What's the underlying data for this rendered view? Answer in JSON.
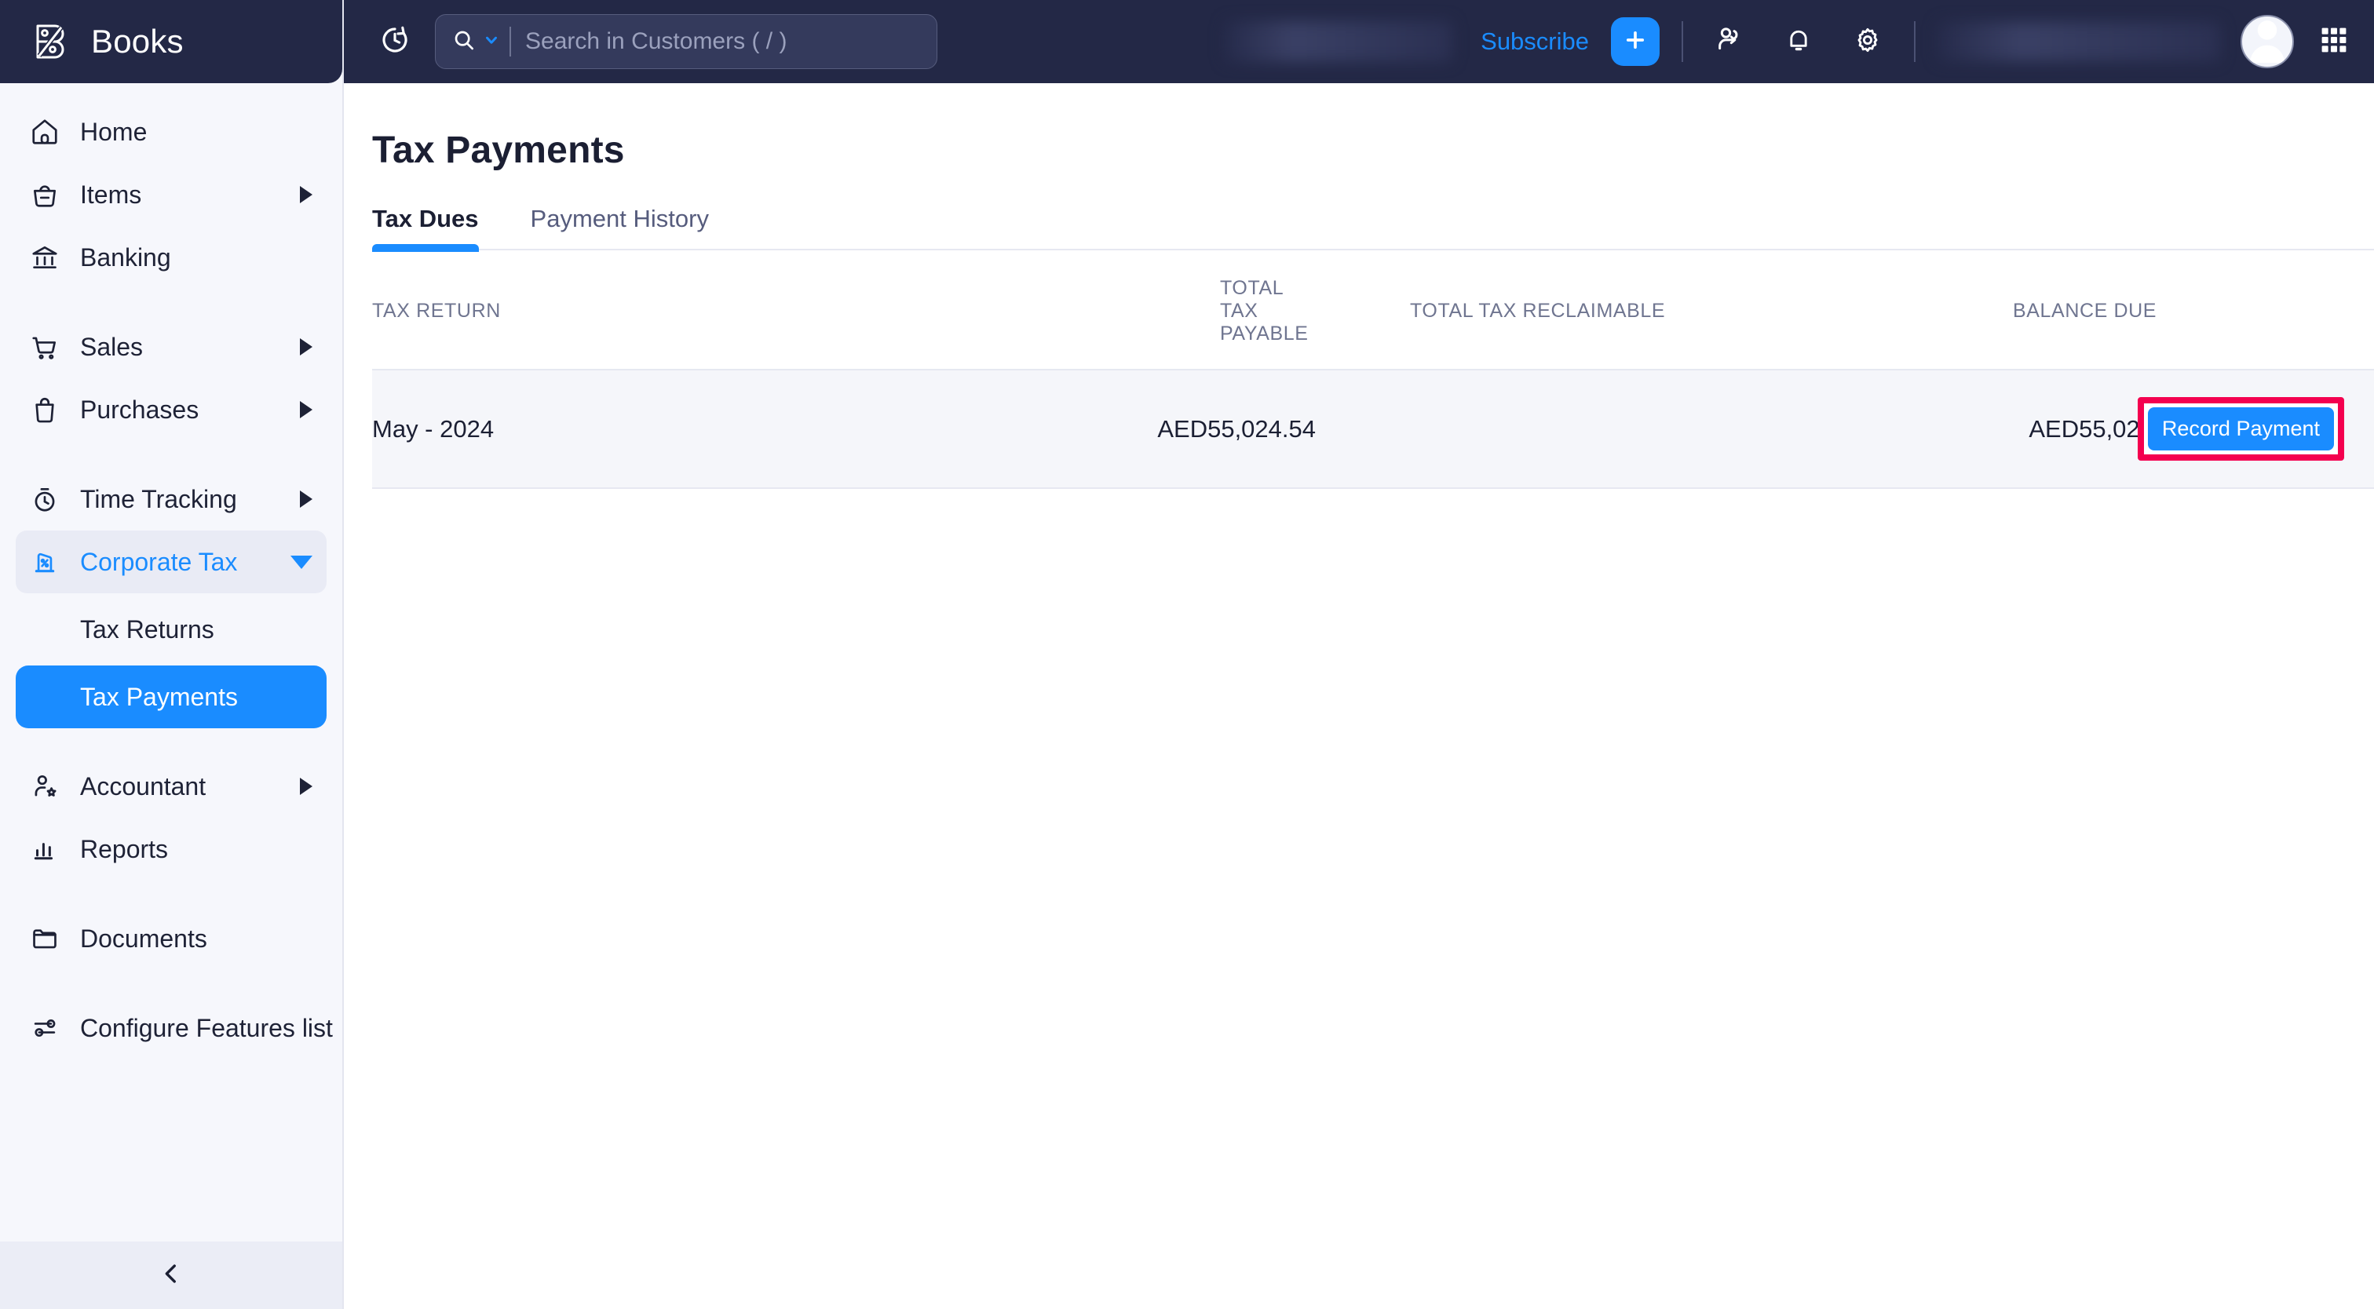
{
  "brand": {
    "name": "Books",
    "logo_icon": "zoho-books-logo-icon"
  },
  "sidebar": {
    "items": [
      {
        "label": "Home",
        "icon": "home-icon",
        "expandable": false
      },
      {
        "label": "Items",
        "icon": "basket-icon",
        "expandable": true
      },
      {
        "label": "Banking",
        "icon": "bank-icon",
        "expandable": false
      },
      {
        "label": "Sales",
        "icon": "shopping-cart-icon",
        "expandable": true
      },
      {
        "label": "Purchases",
        "icon": "shopping-bag-icon",
        "expandable": true
      },
      {
        "label": "Time Tracking",
        "icon": "stopwatch-icon",
        "expandable": true
      },
      {
        "label": "Corporate Tax",
        "icon": "tax-percent-icon",
        "expandable": true,
        "expanded": true
      },
      {
        "label": "Accountant",
        "icon": "accountant-icon",
        "expandable": true
      },
      {
        "label": "Reports",
        "icon": "bar-chart-icon",
        "expandable": false
      },
      {
        "label": "Documents",
        "icon": "folder-icon",
        "expandable": false
      },
      {
        "label": "Configure Features list",
        "icon": "sliders-icon",
        "expandable": false
      }
    ],
    "corporate_tax_children": [
      {
        "label": "Tax Returns",
        "active": false
      },
      {
        "label": "Tax Payments",
        "active": true
      }
    ],
    "collapse_icon": "chevron-left-icon"
  },
  "topbar": {
    "history_icon": "clock-history-icon",
    "search": {
      "icon": "search-icon",
      "dropdown_icon": "chevron-down-icon",
      "placeholder": "Search in Customers ( / )",
      "value": ""
    },
    "trial_info_redacted": "",
    "subscribe_label": "Subscribe",
    "create_new_icon": "plus-icon",
    "referral_icon": "refer-friend-icon",
    "notifications_icon": "bell-icon",
    "settings_icon": "gear-icon",
    "organization_redacted": "",
    "avatar_icon": "user-avatar-icon",
    "apps_icon": "apps-grid-icon"
  },
  "main": {
    "page_title": "Tax Payments",
    "tabs": [
      {
        "label": "Tax Dues",
        "active": true
      },
      {
        "label": "Payment History",
        "active": false
      }
    ],
    "table": {
      "columns": [
        "TAX RETURN",
        "TOTAL TAX PAYABLE",
        "TOTAL TAX RECLAIMABLE",
        "BALANCE DUE",
        ""
      ],
      "rows": [
        {
          "tax_return": "May - 2024",
          "total_tax_payable": "AED55,024.54",
          "total_tax_reclaimable": "",
          "balance_due": "AED55,024.54",
          "action_label": "Record Payment"
        }
      ]
    }
  },
  "colors": {
    "accent_blue": "#1a8cff",
    "header_navy": "#232846",
    "sidebar_bg": "#f6f7fc",
    "highlight_pink": "#f4004f",
    "row_bg": "#f5f6fa"
  }
}
